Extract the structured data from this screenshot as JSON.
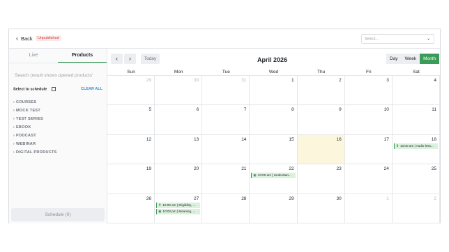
{
  "header": {
    "back_label": "Back",
    "status_badge": "Unpublished",
    "select_placeholder": "Select..."
  },
  "sidebar": {
    "tabs": [
      {
        "label": "Live"
      },
      {
        "label": "Products"
      }
    ],
    "search_placeholder": "Search (result shows opened products’",
    "select_to_schedule": "Select to schedule",
    "clear_all": "CLEAR ALL",
    "categories": [
      "COURSES",
      "MOCK TEST",
      "TEST SERIES",
      "EBOOK",
      "PODCAST",
      "WEBINAR",
      "DIGITAL PRODUCTS"
    ],
    "schedule_button": "Schedule (0)"
  },
  "calendar": {
    "today_label": "Today",
    "month_title": "April 2026",
    "views": [
      "Day",
      "Week",
      "Month"
    ],
    "active_view": "Month",
    "weekdays": [
      "Sun",
      "Mon",
      "Tue",
      "Wed",
      "Thu",
      "Fri",
      "Sat"
    ],
    "weeks": [
      [
        {
          "d": "29",
          "m": true
        },
        {
          "d": "30",
          "m": true
        },
        {
          "d": "31",
          "m": true
        },
        {
          "d": "1"
        },
        {
          "d": "2"
        },
        {
          "d": "3"
        },
        {
          "d": "4"
        }
      ],
      [
        {
          "d": "5"
        },
        {
          "d": "6"
        },
        {
          "d": "7"
        },
        {
          "d": "8"
        },
        {
          "d": "9"
        },
        {
          "d": "10"
        },
        {
          "d": "11"
        }
      ],
      [
        {
          "d": "12"
        },
        {
          "d": "13"
        },
        {
          "d": "14"
        },
        {
          "d": "15"
        },
        {
          "d": "16",
          "today": true
        },
        {
          "d": "17"
        },
        {
          "d": "18",
          "events": [
            {
              "icon": "download-icon",
              "text": "10:00 am | Audio less..."
            }
          ]
        }
      ],
      [
        {
          "d": "19"
        },
        {
          "d": "20"
        },
        {
          "d": "21"
        },
        {
          "d": "22",
          "events": [
            {
              "icon": "play-icon",
              "text": "10:00 am | Understan..."
            }
          ]
        },
        {
          "d": "23"
        },
        {
          "d": "24"
        },
        {
          "d": "25"
        }
      ],
      [
        {
          "d": "26"
        },
        {
          "d": "27",
          "events": [
            {
              "icon": "download-icon",
              "text": "10:00 am | Eligibility, ..."
            },
            {
              "icon": "play-icon",
              "text": "10:02 pm | Meaning, ..."
            }
          ]
        },
        {
          "d": "28"
        },
        {
          "d": "29"
        },
        {
          "d": "30"
        },
        {
          "d": "1",
          "m": true
        },
        {
          "d": "2",
          "m": true
        }
      ]
    ]
  }
}
